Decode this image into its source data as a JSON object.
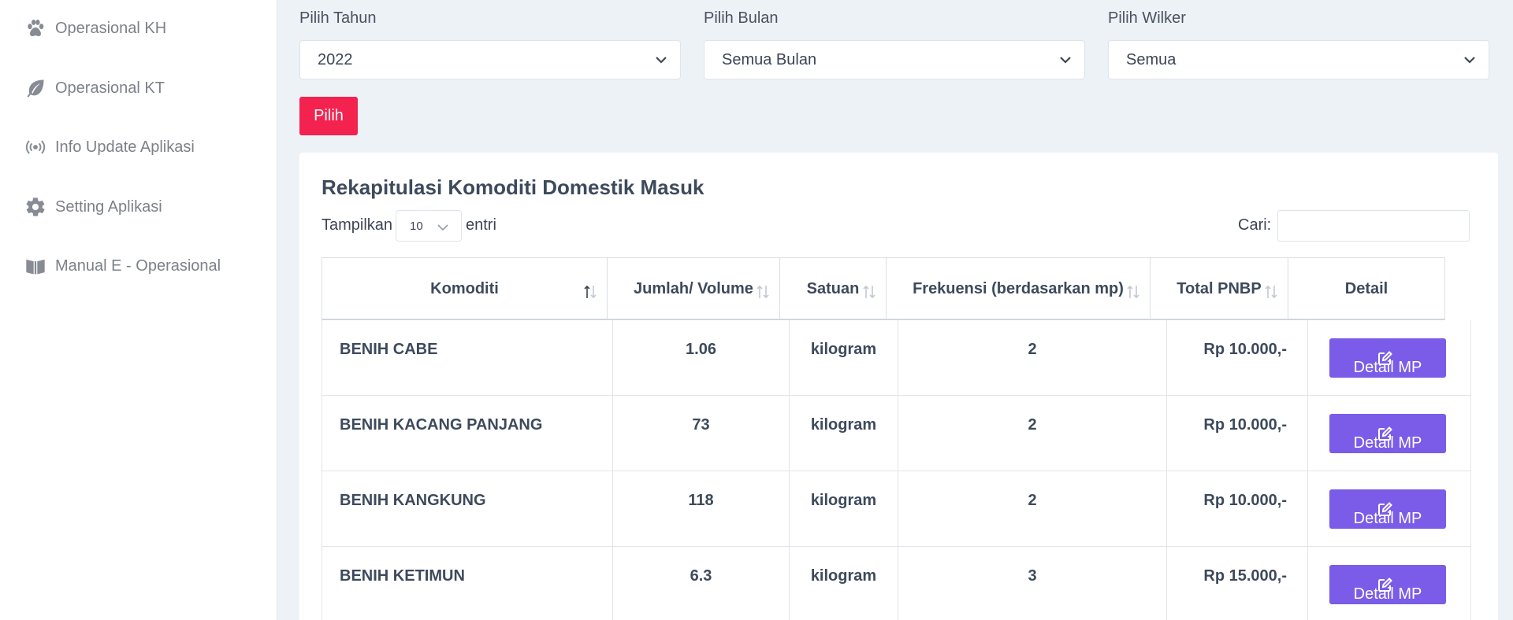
{
  "sidebar": {
    "items": [
      {
        "label": "Operasional KH",
        "icon": "paw-icon"
      },
      {
        "label": "Operasional KT",
        "icon": "leaf-icon"
      },
      {
        "label": "Info Update Aplikasi",
        "icon": "broadcast-icon"
      },
      {
        "label": "Setting Aplikasi",
        "icon": "gear-icon"
      },
      {
        "label": "Manual E - Operasional",
        "icon": "book-icon"
      }
    ]
  },
  "filters": {
    "year": {
      "label": "Pilih Tahun",
      "value": "2022"
    },
    "month": {
      "label": "Pilih Bulan",
      "value": "Semua Bulan"
    },
    "wilker": {
      "label": "Pilih Wilker",
      "value": "Semua"
    },
    "submit_label": "Pilih"
  },
  "card": {
    "title": "Rekapitulasi Komoditi Domestik Masuk",
    "length": {
      "prefix": "Tampilkan",
      "value": "10",
      "suffix": "entri"
    },
    "search_label": "Cari:",
    "search_value": ""
  },
  "table": {
    "headers": [
      "Komoditi",
      "Jumlah/ Volume",
      "Satuan",
      "Frekuensi (berdasarkan mp)",
      "Total PNBP",
      "Detail"
    ],
    "rows": [
      {
        "komoditi": "BENIH CABE",
        "volume": "1.06",
        "satuan": "kilogram",
        "frekuensi": "2",
        "pnbp": "Rp 10.000,-",
        "detail": "Detail MP"
      },
      {
        "komoditi": "BENIH KACANG PANJANG",
        "volume": "73",
        "satuan": "kilogram",
        "frekuensi": "2",
        "pnbp": "Rp 10.000,-",
        "detail": "Detail MP"
      },
      {
        "komoditi": "BENIH KANGKUNG",
        "volume": "118",
        "satuan": "kilogram",
        "frekuensi": "2",
        "pnbp": "Rp 10.000,-",
        "detail": "Detail MP"
      },
      {
        "komoditi": "BENIH KETIMUN",
        "volume": "6.3",
        "satuan": "kilogram",
        "frekuensi": "3",
        "pnbp": "Rp 15.000,-",
        "detail": "Detail MP"
      }
    ]
  },
  "colors": {
    "primary_button": "#f4224f",
    "detail_button": "#7a5ce8",
    "background": "#edf2f7"
  }
}
